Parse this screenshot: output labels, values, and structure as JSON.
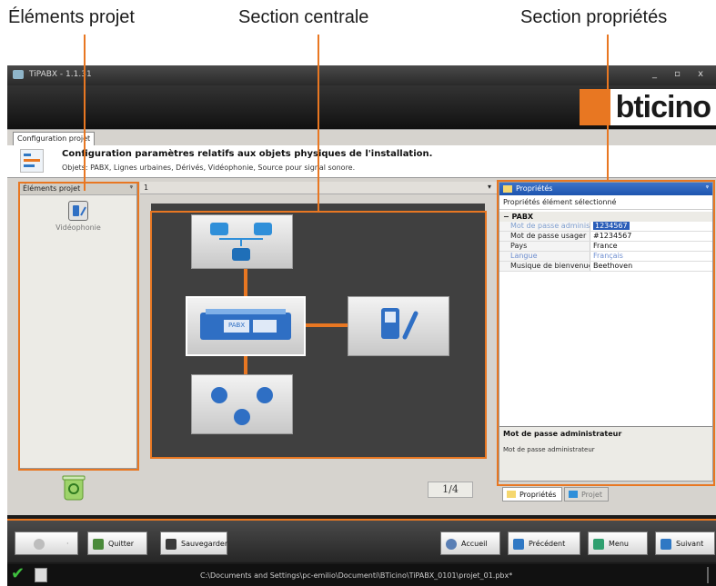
{
  "callouts": {
    "left": "Éléments projet",
    "center": "Section centrale",
    "right": "Section propriétés"
  },
  "window": {
    "title": "TiPABX - 1.1.31",
    "brand": "bticino"
  },
  "tab": {
    "label": "Configuration projet"
  },
  "header": {
    "title": "Configuration paramètres relatifs aux objets physiques de l'installation.",
    "subtitle": "Objets: PABX, Lignes urbaines, Dérivés, Vidéophonie, Source pour signal sonore."
  },
  "left_panel": {
    "title": "Éléments projet",
    "pin": "ᵠ",
    "items": [
      {
        "label": "Vidéophonie"
      }
    ]
  },
  "center_panel": {
    "dropdown_value": "1",
    "dropdown_arrow": "▾",
    "pabx_label": "PABX",
    "page_counter": "1/4"
  },
  "properties": {
    "title": "Propriétés",
    "pin": "ᵠ",
    "subtitle": "Propriétés élément sélectionné",
    "category": "PABX",
    "rows": [
      {
        "key": "Mot de passe administ...",
        "value": "1234567"
      },
      {
        "key": "Mot de passe usager",
        "value": "#1234567"
      },
      {
        "key": "Pays",
        "value": "France"
      },
      {
        "key": "Langue",
        "value": "Français"
      },
      {
        "key": "Musique de bienvenue",
        "value": "Beethoven"
      }
    ],
    "desc_title": "Mot de passe administrateur",
    "desc_text": "Mot de passe administrateur",
    "tabs": [
      "Propriétés",
      "Projet"
    ]
  },
  "toolbar": {
    "quit": "Quitter",
    "save": "Sauvegarder",
    "home": "Accueil",
    "prev": "Précédent",
    "menu": "Menu",
    "next": "Suivant"
  },
  "status": {
    "path": "C:\\Documents and Settings\\pc-emilio\\Documenti\\BTicino\\TiPABX_0101\\projet_01.pbx*"
  },
  "colors": {
    "accent": "#e87722",
    "selection": "#2a5db8"
  }
}
